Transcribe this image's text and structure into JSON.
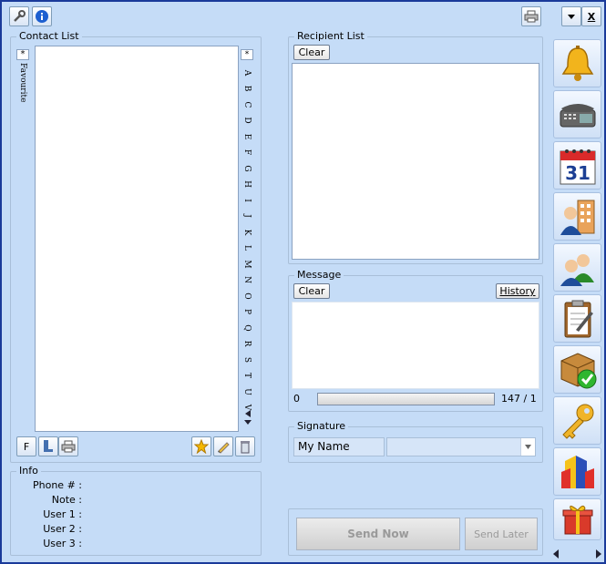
{
  "toolbar": {
    "tools_icon": "wrench-icon",
    "info_icon": "info-icon",
    "print_icon": "printer-icon",
    "menu_icon": "chevron-down-icon",
    "close_label": "X"
  },
  "contacts": {
    "title": "Contact List",
    "star_label": "*",
    "favourite_label": "Favourite",
    "alphabet": [
      "*",
      "A",
      "B",
      "C",
      "D",
      "E",
      "F",
      "G",
      "H",
      "I",
      "J",
      "K",
      "L",
      "M",
      "N",
      "O",
      "P",
      "Q",
      "R",
      "S",
      "T",
      "U",
      "V"
    ],
    "f_button": "F"
  },
  "info": {
    "title": "Info",
    "fields": [
      {
        "label": "Phone # :"
      },
      {
        "label": "Note :"
      },
      {
        "label": "User 1 :"
      },
      {
        "label": "User 2 :"
      },
      {
        "label": "User 3 :"
      }
    ]
  },
  "recipient": {
    "title": "Recipient List",
    "clear_label": "Clear"
  },
  "message": {
    "title": "Message",
    "clear_label": "Clear",
    "history_label": "History",
    "count_left": "0",
    "count_right": "147 / 1",
    "progress": 0
  },
  "signature": {
    "title": "Signature",
    "name": "My Name",
    "dropdown_value": ""
  },
  "actions": {
    "send_now": "Send Now",
    "send_later": "Send Later"
  },
  "sidebar": [
    {
      "icon": "bell-icon"
    },
    {
      "icon": "telephone-icon"
    },
    {
      "icon": "calendar-icon",
      "text": "31"
    },
    {
      "icon": "contact-building-icon"
    },
    {
      "icon": "group-icon"
    },
    {
      "icon": "clipboard-icon"
    },
    {
      "icon": "package-check-icon"
    },
    {
      "icon": "key-icon"
    },
    {
      "icon": "chart-icon"
    },
    {
      "icon": "gift-icon"
    }
  ],
  "colors": {
    "background": "#c5dcf7",
    "border": "#1a3a9a"
  }
}
